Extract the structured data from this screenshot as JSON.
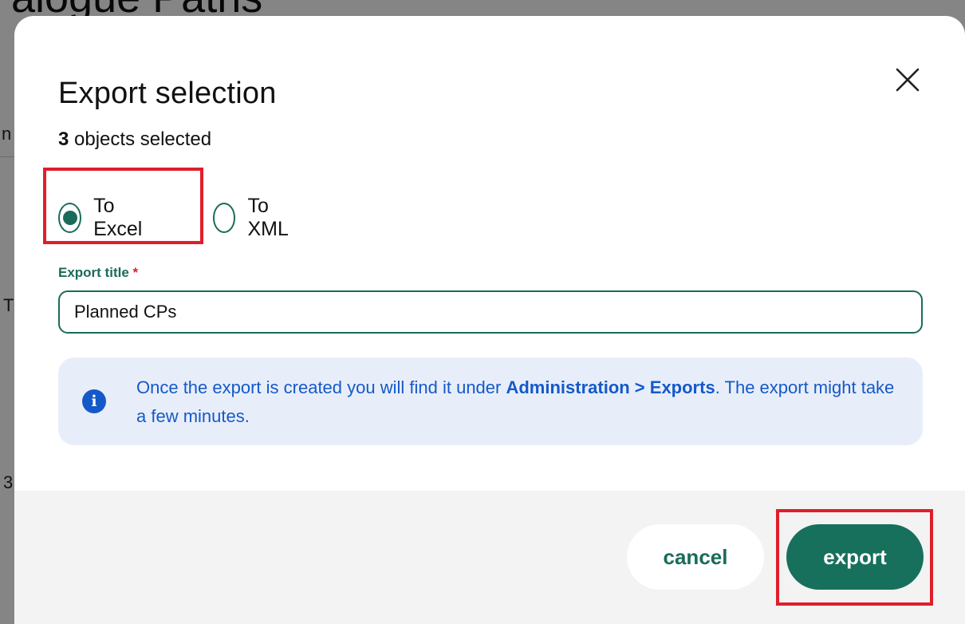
{
  "background": {
    "title_fragment": "alogue Paths",
    "frag_a": "n",
    "frag_b": "T",
    "frag_c": "3"
  },
  "modal": {
    "title": "Export selection",
    "close_icon": "close-icon",
    "selection_count": "3",
    "selection_suffix": " objects selected",
    "format_options": [
      {
        "label": "To Excel",
        "selected": true
      },
      {
        "label": "To XML",
        "selected": false
      }
    ],
    "export_title": {
      "label": "Export title",
      "required_mark": "*",
      "value": "Planned CPs"
    },
    "info": {
      "icon": "info-icon",
      "text_before": "Once the export is created you will find it under ",
      "text_bold": "Administration > Exports",
      "text_after": ". The export might take a few minutes."
    },
    "buttons": {
      "cancel": "cancel",
      "export": "export"
    }
  },
  "colors": {
    "accent": "#17705c",
    "info_text": "#1559c9",
    "info_bg": "#e8eef9",
    "highlight": "#e01e2a",
    "required": "#d0242d"
  }
}
